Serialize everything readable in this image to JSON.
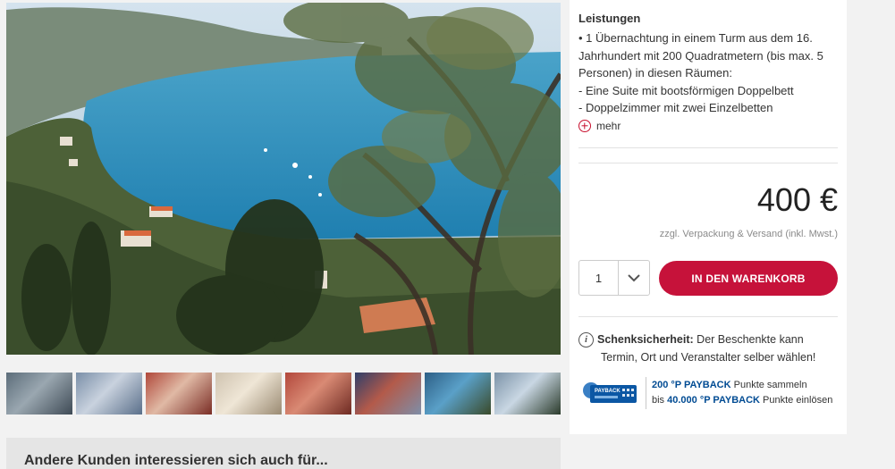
{
  "hero": {
    "icon": "landscape-photo"
  },
  "thumbnails": [
    {
      "name": "thumb-1",
      "colors": [
        "#5c6d7a",
        "#9aa7b0",
        "#3e4a55"
      ]
    },
    {
      "name": "thumb-2",
      "colors": [
        "#7a8fa8",
        "#c9d2de",
        "#5a6f8a"
      ]
    },
    {
      "name": "thumb-3",
      "colors": [
        "#b0483a",
        "#e0b9a5",
        "#7a2d25"
      ]
    },
    {
      "name": "thumb-4",
      "colors": [
        "#cfc3b0",
        "#efe6d6",
        "#9a8a72"
      ]
    },
    {
      "name": "thumb-5",
      "colors": [
        "#b2473b",
        "#d98a74",
        "#6e2a22"
      ]
    },
    {
      "name": "thumb-6",
      "colors": [
        "#2f3f6a",
        "#b35a4a",
        "#7e8ea8"
      ]
    },
    {
      "name": "thumb-7",
      "colors": [
        "#2d5f86",
        "#5aa0c8",
        "#3a4a2a"
      ]
    },
    {
      "name": "thumb-8",
      "colors": [
        "#7c93a8",
        "#c9d7e3",
        "#2b3b2b"
      ]
    }
  ],
  "details": {
    "title": "Leistungen",
    "lines": [
      "• 1 Übernachtung in einem Turm aus dem 16.",
      "Jahrhundert mit 200 Quadratmetern (bis max. 5",
      "Personen) in diesen Räumen:",
      "- Eine Suite mit bootsförmigen Doppelbett",
      "- Doppelzimmer mit zwei Einzelbetten"
    ],
    "more_label": "mehr"
  },
  "price": {
    "amount": "400 €",
    "shipping": "zzgl. Verpackung & Versand (inkl. Mwst.)"
  },
  "quantity": {
    "value": "1"
  },
  "cart_button": {
    "label": "IN DEN WARENKORB"
  },
  "gift_info": {
    "bold": "Schenksicherheit:",
    "text1": " Der Beschenkte kann",
    "text2": "Termin, Ort und Veranstalter selber wählen!"
  },
  "payback": {
    "logo_text": "PAYBACK",
    "line1_bold": "200 °P PAYBACK",
    "line1_rest": " Punkte sammeln",
    "line2_pre": "bis ",
    "line2_bold": "40.000 °P PAYBACK",
    "line2_rest": " Punkte einlösen"
  },
  "recommend": {
    "title": "Andere Kunden interessieren sich auch für..."
  },
  "colors": {
    "accent": "#c6123a",
    "payback_blue": "#004b93"
  }
}
